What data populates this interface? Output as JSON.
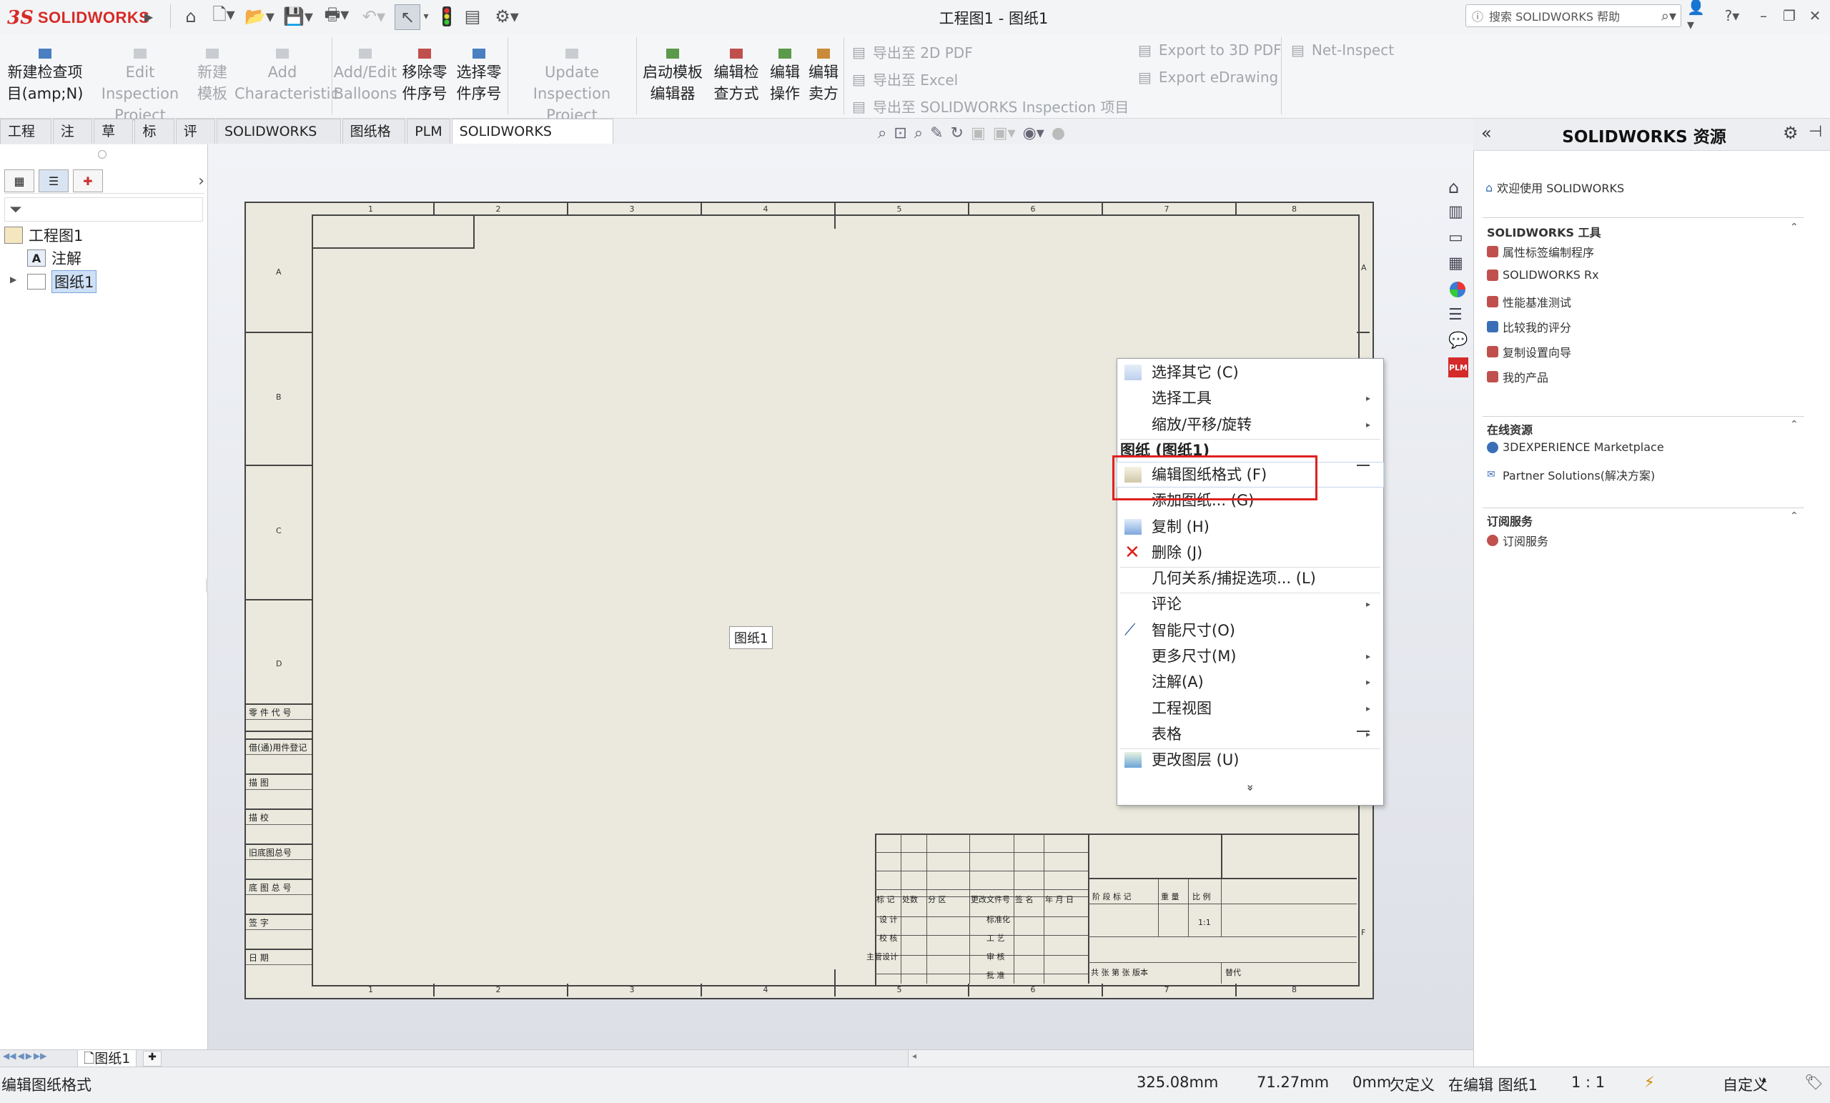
{
  "app": {
    "brand": "SOLIDWORKS",
    "window_title": "工程图1 - 图纸1",
    "help_search_placeholder": "搜索 SOLIDWORKS 帮助"
  },
  "ribbon": {
    "new_project": [
      "新建检查项",
      "目(amp;N)"
    ],
    "edit_project": [
      "Edit Inspection",
      "Project"
    ],
    "new_template": [
      "新建",
      "模板"
    ],
    "add_characteristic": [
      "Add",
      "Characteristic"
    ],
    "add_edit_balloons": [
      "Add/Edit",
      "Balloons"
    ],
    "remove_part_number": [
      "移除零",
      "件序号"
    ],
    "select_part_number": [
      "选择零",
      "件序号"
    ],
    "update_project": [
      "Update Inspection",
      "Project"
    ],
    "template_editor": [
      "启动模板",
      "编辑器"
    ],
    "edit_inspection_method": [
      "编辑检",
      "查方式"
    ],
    "edit_operation": [
      "编辑",
      "操作"
    ],
    "edit_vendor": [
      "编辑",
      "卖方"
    ],
    "export_2d_pdf": "导出至 2D PDF",
    "export_excel": "导出至 Excel",
    "export_sw_inspection": "导出至 SOLIDWORKS Inspection 项目",
    "export_3d_pdf": "Export to 3D PDF",
    "export_edrawing": "Export eDrawing",
    "net_inspect": "Net-Inspect"
  },
  "tabs": [
    "工程图",
    "注解",
    "草图",
    "标注",
    "评估",
    "SOLIDWORKS 插件",
    "图纸格式",
    "PLM",
    "SOLIDWORKS Inspection"
  ],
  "tree": {
    "root": "工程图1",
    "annotations": "注解",
    "sheet": "图纸1"
  },
  "drawing": {
    "sheet_label": "图纸1",
    "col_nums": [
      "1",
      "2",
      "3",
      "4",
      "5",
      "6",
      "7",
      "8"
    ],
    "row_letters": [
      "A",
      "B",
      "C",
      "D"
    ],
    "right_letters": [
      "A",
      "F"
    ],
    "left_block_labels": [
      "零 件 代 号",
      "借(通)用件登记",
      "描 图",
      "描 校",
      "旧底图总号",
      "底 图 总 号",
      "签 字",
      "日 期"
    ],
    "title_row_labels": [
      "标 记",
      "处数",
      "分 区",
      "更改文件号",
      "签 名",
      "年 月 日"
    ],
    "title_side_labels": [
      "设 计",
      "校 核",
      "主管设计"
    ],
    "title_mid_labels": [
      "标准化",
      "工 艺",
      "审 核",
      "批 准"
    ],
    "title_right_labels": [
      "阶 段 标 记",
      "重 量",
      "比 例"
    ],
    "scale_value": "1:1",
    "sheet_count": "共 张 第 张 版本",
    "replace": "替代"
  },
  "context_menu": {
    "items": [
      {
        "label": "选择其它 (C)",
        "submenu": false
      },
      {
        "label": "选择工具",
        "submenu": true
      },
      {
        "label": "缩放/平移/旋转",
        "submenu": true
      },
      {
        "label": "图纸 (图纸1)",
        "header": true
      },
      {
        "label": "编辑图纸格式 (F)",
        "submenu": false
      },
      {
        "label": "添加图纸... (G)",
        "submenu": false
      },
      {
        "label": "复制 (H)",
        "submenu": false
      },
      {
        "label": "删除 (J)",
        "submenu": false
      },
      {
        "label": "几何关系/捕捉选项... (L)",
        "submenu": false
      },
      {
        "label": "评论",
        "submenu": true
      },
      {
        "label": "智能尺寸(O)",
        "submenu": false
      },
      {
        "label": "更多尺寸(M)",
        "submenu": true
      },
      {
        "label": "注解(A)",
        "submenu": true
      },
      {
        "label": "工程视图",
        "submenu": true
      },
      {
        "label": "表格",
        "submenu": true
      },
      {
        "label": "更改图层 (U)",
        "submenu": false
      }
    ],
    "more": "»"
  },
  "resources": {
    "title": "SOLIDWORKS 资源",
    "welcome": "欢迎使用  SOLIDWORKS",
    "tools_title": "SOLIDWORKS 工具",
    "tools": [
      "属性标签编制程序",
      "SOLIDWORKS Rx",
      "性能基准测试",
      "比较我的评分",
      "复制设置向导",
      "我的产品"
    ],
    "online_title": "在线资源",
    "online": [
      "3DEXPERIENCE Marketplace",
      "Partner Solutions(解决方案)"
    ],
    "subscription_title": "订阅服务",
    "subscription": [
      "订阅服务"
    ]
  },
  "sheet_tab": "图纸1",
  "status": {
    "message": "编辑图纸格式",
    "x": "325.08mm",
    "y": "71.27mm",
    "z": "0mm",
    "defined": "欠定义",
    "editing": "在编辑 图纸1",
    "scale": "1 : 1",
    "units": "自定义"
  }
}
